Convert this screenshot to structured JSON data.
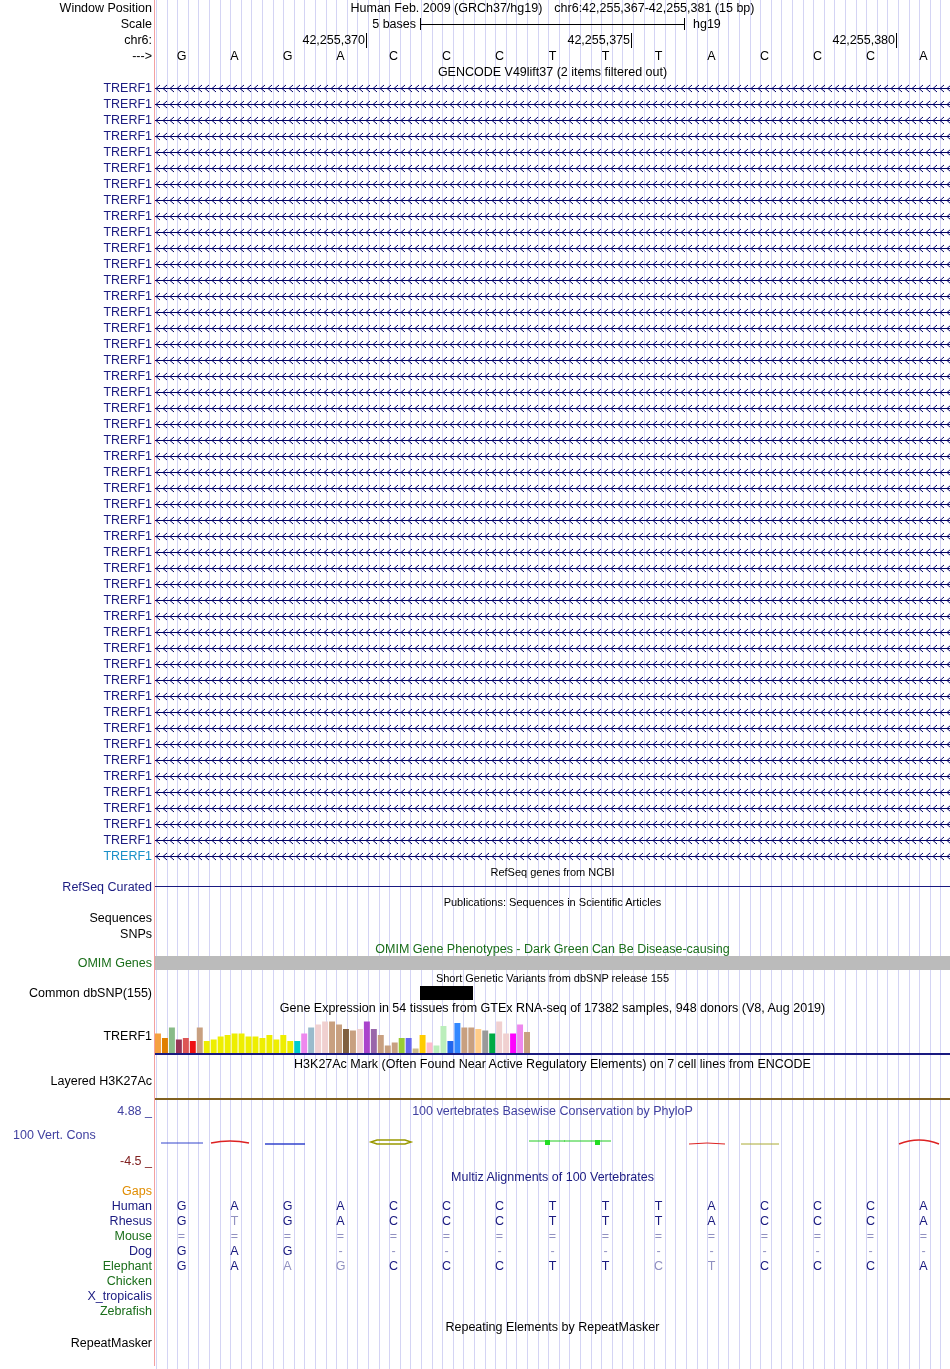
{
  "header": {
    "assembly": "Human Feb. 2009 (GRCh37/hg19)",
    "position": "chr6:42,255,367-42,255,381 (15 bp)"
  },
  "labels": {
    "window_position": "Window Position",
    "scale": "Scale",
    "chromosome": "chr6:",
    "strand": "--->"
  },
  "scale": {
    "span": "5 bases",
    "assembly": "hg19"
  },
  "bases": [
    {
      "base": "G"
    },
    {
      "base": "A"
    },
    {
      "base": "G"
    },
    {
      "base": "A",
      "coordinate": "42,255,370"
    },
    {
      "base": "C"
    },
    {
      "base": "C"
    },
    {
      "base": "C"
    },
    {
      "base": "T"
    },
    {
      "base": "T",
      "coordinate": "42,255,375"
    },
    {
      "base": "T"
    },
    {
      "base": "A"
    },
    {
      "base": "C"
    },
    {
      "base": "C"
    },
    {
      "base": "C",
      "coordinate": "42,255,380"
    },
    {
      "base": "A"
    }
  ],
  "gencode": {
    "title": "GENCODE V49lift37 (2 items filtered out)",
    "items": [
      {
        "label": "TRERF1",
        "selected": false
      },
      {
        "label": "TRERF1",
        "selected": false
      },
      {
        "label": "TRERF1",
        "selected": false
      },
      {
        "label": "TRERF1",
        "selected": false
      },
      {
        "label": "TRERF1",
        "selected": false
      },
      {
        "label": "TRERF1",
        "selected": false
      },
      {
        "label": "TRERF1",
        "selected": false
      },
      {
        "label": "TRERF1",
        "selected": false
      },
      {
        "label": "TRERF1",
        "selected": false
      },
      {
        "label": "TRERF1",
        "selected": false
      },
      {
        "label": "TRERF1",
        "selected": false
      },
      {
        "label": "TRERF1",
        "selected": false
      },
      {
        "label": "TRERF1",
        "selected": false
      },
      {
        "label": "TRERF1",
        "selected": false
      },
      {
        "label": "TRERF1",
        "selected": false
      },
      {
        "label": "TRERF1",
        "selected": false
      },
      {
        "label": "TRERF1",
        "selected": false
      },
      {
        "label": "TRERF1",
        "selected": false
      },
      {
        "label": "TRERF1",
        "selected": false
      },
      {
        "label": "TRERF1",
        "selected": false
      },
      {
        "label": "TRERF1",
        "selected": false
      },
      {
        "label": "TRERF1",
        "selected": false
      },
      {
        "label": "TRERF1",
        "selected": false
      },
      {
        "label": "TRERF1",
        "selected": false
      },
      {
        "label": "TRERF1",
        "selected": false
      },
      {
        "label": "TRERF1",
        "selected": false
      },
      {
        "label": "TRERF1",
        "selected": false
      },
      {
        "label": "TRERF1",
        "selected": false
      },
      {
        "label": "TRERF1",
        "selected": false
      },
      {
        "label": "TRERF1",
        "selected": false
      },
      {
        "label": "TRERF1",
        "selected": false
      },
      {
        "label": "TRERF1",
        "selected": false
      },
      {
        "label": "TRERF1",
        "selected": false
      },
      {
        "label": "TRERF1",
        "selected": false
      },
      {
        "label": "TRERF1",
        "selected": false
      },
      {
        "label": "TRERF1",
        "selected": false
      },
      {
        "label": "TRERF1",
        "selected": false
      },
      {
        "label": "TRERF1",
        "selected": false
      },
      {
        "label": "TRERF1",
        "selected": false
      },
      {
        "label": "TRERF1",
        "selected": false
      },
      {
        "label": "TRERF1",
        "selected": false
      },
      {
        "label": "TRERF1",
        "selected": false
      },
      {
        "label": "TRERF1",
        "selected": false
      },
      {
        "label": "TRERF1",
        "selected": false
      },
      {
        "label": "TRERF1",
        "selected": false
      },
      {
        "label": "TRERF1",
        "selected": false
      },
      {
        "label": "TRERF1",
        "selected": false
      },
      {
        "label": "TRERF1",
        "selected": false
      },
      {
        "label": "TRERF1",
        "selected": true
      }
    ]
  },
  "refseq": {
    "title": "RefSeq genes from NCBI",
    "label": "RefSeq Curated"
  },
  "publications": {
    "title": "Publications: Sequences in Scientific Articles",
    "labels": [
      "Sequences",
      "SNPs"
    ]
  },
  "omim": {
    "title": "OMIM Gene Phenotypes - Dark Green Can Be Disease-causing",
    "label": "OMIM Genes"
  },
  "dbsnp": {
    "title": "Short Genetic Variants from dbSNP release 155",
    "label": "Common dbSNP(155)"
  },
  "gtex": {
    "title": "Gene Expression in 54 tissues from GTEx RNA-seq of 17382 samples, 948 donors (V8, Aug 2019)",
    "label": "TRERF1"
  },
  "h3k27ac": {
    "title": "H3K27Ac Mark (Often Found Near Active Regulatory Elements) on 7 cell lines from ENCODE",
    "label": "Layered H3K27Ac"
  },
  "phylop": {
    "title": "100 vertebrates Basewise Conservation by PhyloP",
    "label": "100 Vert. Cons",
    "max": "4.88 _",
    "min": "-4.5 _"
  },
  "multiz": {
    "title": "Multiz Alignments of 100 Vertebrates",
    "species": [
      {
        "name": "Gaps",
        "color": "#e08c00"
      },
      {
        "name": "Human",
        "color": "#1a1a80",
        "bases": [
          {
            "b": "G",
            "faded": false
          },
          {
            "b": "A",
            "faded": false
          },
          {
            "b": "G",
            "faded": false
          },
          {
            "b": "A",
            "faded": false
          },
          {
            "b": "C",
            "faded": false
          },
          {
            "b": "C",
            "faded": false
          },
          {
            "b": "C",
            "faded": false
          },
          {
            "b": "T",
            "faded": false
          },
          {
            "b": "T",
            "faded": false
          },
          {
            "b": "T",
            "faded": false
          },
          {
            "b": "A",
            "faded": false
          },
          {
            "b": "C",
            "faded": false
          },
          {
            "b": "C",
            "faded": false
          },
          {
            "b": "C",
            "faded": false
          },
          {
            "b": "A",
            "faded": false
          }
        ]
      },
      {
        "name": "Rhesus",
        "color": "#1a1a80",
        "bases": [
          {
            "b": "G",
            "faded": false
          },
          {
            "b": "T",
            "faded": true
          },
          {
            "b": "G",
            "faded": false
          },
          {
            "b": "A",
            "faded": false
          },
          {
            "b": "C",
            "faded": false
          },
          {
            "b": "C",
            "faded": false
          },
          {
            "b": "C",
            "faded": false
          },
          {
            "b": "T",
            "faded": false
          },
          {
            "b": "T",
            "faded": false
          },
          {
            "b": "T",
            "faded": false
          },
          {
            "b": "A",
            "faded": false
          },
          {
            "b": "C",
            "faded": false
          },
          {
            "b": "C",
            "faded": false
          },
          {
            "b": "C",
            "faded": false
          },
          {
            "b": "A",
            "faded": false
          }
        ]
      },
      {
        "name": "Mouse",
        "color": "#1a6e1a",
        "bases": [
          {
            "b": "=",
            "faded": true
          },
          {
            "b": "=",
            "faded": true
          },
          {
            "b": "=",
            "faded": true
          },
          {
            "b": "=",
            "faded": true
          },
          {
            "b": "=",
            "faded": true
          },
          {
            "b": "=",
            "faded": true
          },
          {
            "b": "=",
            "faded": true
          },
          {
            "b": "=",
            "faded": true
          },
          {
            "b": "=",
            "faded": true
          },
          {
            "b": "=",
            "faded": true
          },
          {
            "b": "=",
            "faded": true
          },
          {
            "b": "=",
            "faded": true
          },
          {
            "b": "=",
            "faded": true
          },
          {
            "b": "=",
            "faded": true
          },
          {
            "b": "=",
            "faded": true
          }
        ]
      },
      {
        "name": "Dog",
        "color": "#1a1a80",
        "bases": [
          {
            "b": "G",
            "faded": false
          },
          {
            "b": "A",
            "faded": false
          },
          {
            "b": "G",
            "faded": false
          },
          {
            "b": "-",
            "faded": true
          },
          {
            "b": "-",
            "faded": true
          },
          {
            "b": "-",
            "faded": true
          },
          {
            "b": "-",
            "faded": true
          },
          {
            "b": "-",
            "faded": true
          },
          {
            "b": "-",
            "faded": true
          },
          {
            "b": "-",
            "faded": true
          },
          {
            "b": "-",
            "faded": true
          },
          {
            "b": "-",
            "faded": true
          },
          {
            "b": "-",
            "faded": true
          },
          {
            "b": "-",
            "faded": true
          },
          {
            "b": "-",
            "faded": true
          }
        ]
      },
      {
        "name": "Elephant",
        "color": "#1a6e1a",
        "bases": [
          {
            "b": "G",
            "faded": false
          },
          {
            "b": "A",
            "faded": false
          },
          {
            "b": "A",
            "faded": true
          },
          {
            "b": "G",
            "faded": true
          },
          {
            "b": "C",
            "faded": false
          },
          {
            "b": "C",
            "faded": false
          },
          {
            "b": "C",
            "faded": false
          },
          {
            "b": "T",
            "faded": false
          },
          {
            "b": "T",
            "faded": false
          },
          {
            "b": "C",
            "faded": true
          },
          {
            "b": "T",
            "faded": true
          },
          {
            "b": "C",
            "faded": false
          },
          {
            "b": "C",
            "faded": false
          },
          {
            "b": "C",
            "faded": false
          },
          {
            "b": "A",
            "faded": false
          }
        ]
      },
      {
        "name": "Chicken",
        "color": "#1a6e1a"
      },
      {
        "name": "X_tropicalis",
        "color": "#1a1a80"
      },
      {
        "name": "Zebrafish",
        "color": "#1a6e1a"
      }
    ]
  },
  "repeatmasker": {
    "title": "Repeating Elements by RepeatMasker",
    "label": "RepeatMasker"
  }
}
